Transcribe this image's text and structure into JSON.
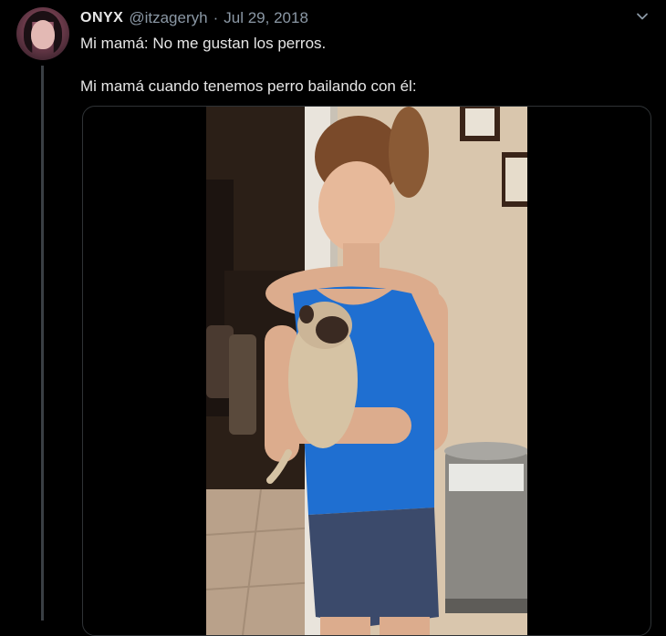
{
  "tweet": {
    "author": {
      "display_name": "ONYX",
      "handle": "@itzageryh"
    },
    "separator": "·",
    "date": "Jul 29, 2018",
    "text_lines": [
      "Mi mamá: No me gustan los perros.",
      "Mi mamá cuando tenemos perro bailando con él:"
    ],
    "menu_icon": "chevron-down-icon",
    "media_type": "video"
  },
  "colors": {
    "background": "#000000",
    "text": "#e6e6e6",
    "secondary_text": "#8b98a5",
    "border": "#2f3336",
    "thread_line": "#3a3f44"
  }
}
